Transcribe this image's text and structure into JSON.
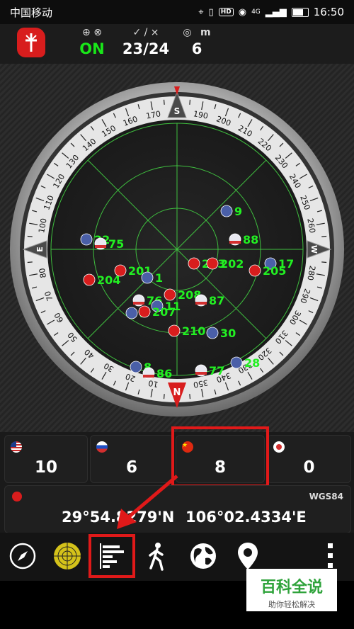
{
  "status_bar": {
    "carrier": "中国移动",
    "time": "16:50",
    "hd_badge": "HD",
    "network": "4G"
  },
  "summary": {
    "gps_status": "ON",
    "satellites": "23",
    "satellites_total": "24",
    "accuracy": "6",
    "accuracy_unit": "m"
  },
  "radar": {
    "compass_labels": {
      "north": "N",
      "south": "S",
      "east": "E",
      "west": "W"
    },
    "bearing_numbers": [
      "10",
      "20",
      "30",
      "40",
      "50",
      "60",
      "70",
      "80",
      "100",
      "110",
      "120",
      "130",
      "140",
      "150",
      "160",
      "170",
      "190",
      "200",
      "210",
      "220",
      "230",
      "240",
      "250",
      "260",
      "280",
      "290",
      "300",
      "310",
      "320",
      "330",
      "340",
      "350"
    ],
    "satellites": [
      {
        "id": "9",
        "constellation": "gps"
      },
      {
        "id": "22",
        "constellation": "gps"
      },
      {
        "id": "75",
        "constellation": "glonass"
      },
      {
        "id": "88",
        "constellation": "glonass"
      },
      {
        "id": "17",
        "constellation": "gps"
      },
      {
        "id": "205",
        "constellation": "beidou"
      },
      {
        "id": "203",
        "constellation": "beidou"
      },
      {
        "id": "202",
        "constellation": "beidou"
      },
      {
        "id": "204",
        "constellation": "beidou"
      },
      {
        "id": "201",
        "constellation": "beidou"
      },
      {
        "id": "1",
        "constellation": "gps"
      },
      {
        "id": "208",
        "constellation": "beidou"
      },
      {
        "id": "87",
        "constellation": "glonass"
      },
      {
        "id": "76",
        "constellation": "glonass"
      },
      {
        "id": "11",
        "constellation": "gps"
      },
      {
        "id": "3",
        "constellation": "gps"
      },
      {
        "id": "207",
        "constellation": "beidou"
      },
      {
        "id": "210",
        "constellation": "beidou"
      },
      {
        "id": "30",
        "constellation": "gps"
      },
      {
        "id": "28",
        "constellation": "gps"
      },
      {
        "id": "8",
        "constellation": "gps"
      },
      {
        "id": "86",
        "constellation": "glonass"
      },
      {
        "id": "77",
        "constellation": "glonass"
      }
    ]
  },
  "constellations": [
    {
      "name": "gps",
      "count": "10"
    },
    {
      "name": "glonass",
      "count": "6"
    },
    {
      "name": "beidou",
      "count": "8"
    },
    {
      "name": "other",
      "count": "0"
    }
  ],
  "position": {
    "datum": "WGS84",
    "latitude": "29°54.8279'N",
    "longitude": "106°02.4334'E"
  },
  "toolbar": [
    "compass-icon",
    "radar-icon",
    "signal-bars-icon",
    "walking-person-icon",
    "globe-icon",
    "map-pin-icon",
    "more-icon"
  ],
  "watermark": {
    "title": "百科全说",
    "subtitle": "助你轻松解决"
  },
  "colors": {
    "accent_green": "#19e619",
    "highlight_red": "#e01919",
    "satellite_label": "#22f022"
  }
}
